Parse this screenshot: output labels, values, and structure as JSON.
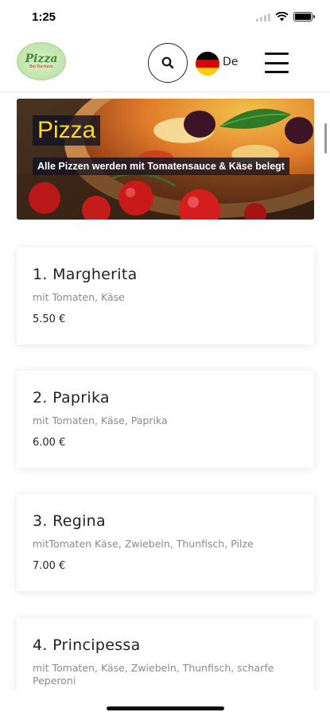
{
  "status_bar": {
    "time": "1:25"
  },
  "header": {
    "logo_text": "Pizza",
    "logo_subtext": "Bei Barbara",
    "language": "De",
    "flag_colors": [
      "#000000",
      "#dd0000",
      "#ffce00"
    ]
  },
  "banner": {
    "title": "Pizza",
    "description": "Alle Pizzen werden mit Tomatensauce & Käse belegt"
  },
  "menu_items": [
    {
      "name": "1. Margherita",
      "description": "mit Tomaten, Käse",
      "price": "5.50 €"
    },
    {
      "name": "2. Paprika",
      "description": "mit Tomaten, Käse, Paprika",
      "price": "6.00 €"
    },
    {
      "name": "3. Regina",
      "description": "mitTomaten Käse, Zwiebeln, Thunfisch, Pilze",
      "price": "7.00 €"
    },
    {
      "name": "4. Principessa",
      "description": "mit Tomaten, Käse, Zwiebeln, Thunfisch, scharfe Peperoni",
      "price": ""
    }
  ],
  "colors": {
    "banner_title": "#ffd820",
    "label_background": "#14141f"
  }
}
